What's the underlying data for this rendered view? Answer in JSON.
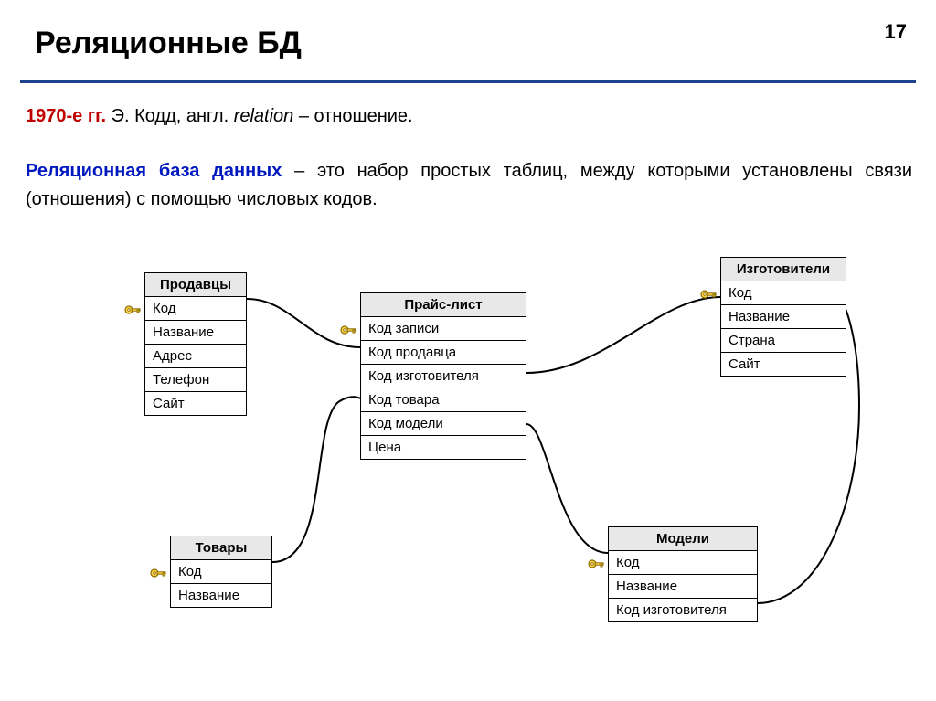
{
  "page": {
    "title": "Реляционные БД",
    "number": "17"
  },
  "intro": {
    "year_prefix": "1970-е гг.",
    "author": " Э. Кодд, англ. ",
    "italic_word": "relation",
    "after_italic": " – отношение."
  },
  "definition": {
    "term": "Реляционная база данных",
    "rest": " – это набор простых таблиц, между которыми установлены связи (отношения) с помощью числовых кодов."
  },
  "tables": {
    "sellers": {
      "title": "Продавцы",
      "rows": [
        "Код",
        "Название",
        "Адрес",
        "Телефон",
        "Сайт"
      ]
    },
    "pricelist": {
      "title": "Прайс-лист",
      "rows": [
        "Код записи",
        "Код продавца",
        "Код изготовителя",
        "Код товара",
        "Код модели",
        "Цена"
      ]
    },
    "manufacturers": {
      "title": "Изготовители",
      "rows": [
        "Код",
        "Название",
        "Страна",
        "Сайт"
      ]
    },
    "goods": {
      "title": "Товары",
      "rows": [
        "Код",
        "Название"
      ]
    },
    "models": {
      "title": "Модели",
      "rows": [
        "Код",
        "Название",
        "Код изготовителя"
      ]
    }
  }
}
